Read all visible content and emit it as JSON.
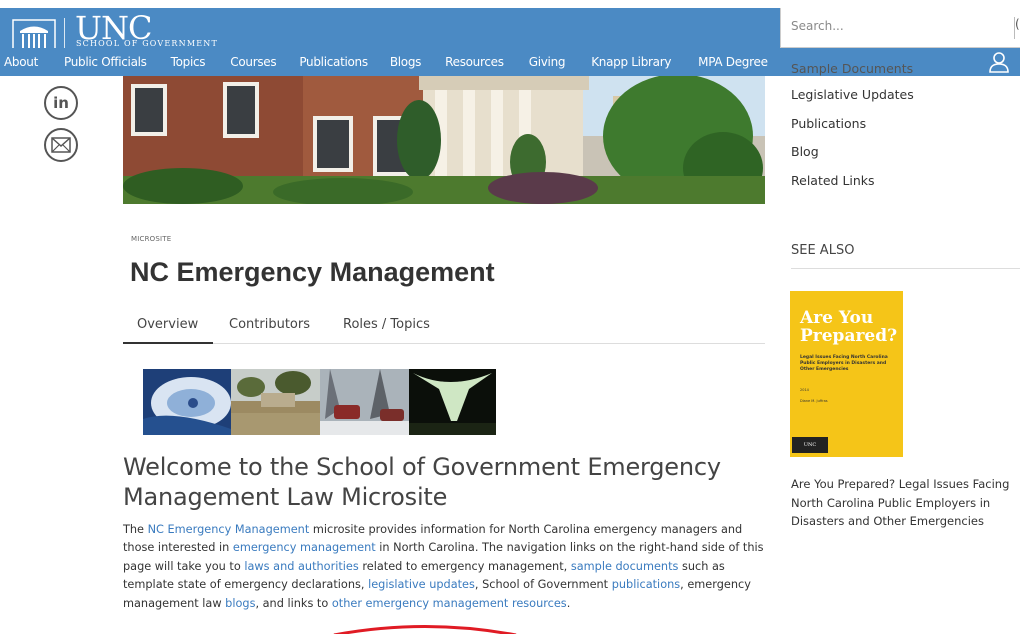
{
  "header": {
    "logo_text": "UNC",
    "logo_subtitle": "SCHOOL OF GOVERNMENT",
    "search_placeholder": "Search...",
    "search_button_partial": "("
  },
  "nav": {
    "items": [
      {
        "label": "About"
      },
      {
        "label": "Public Officials"
      },
      {
        "label": "Topics"
      },
      {
        "label": "Courses"
      },
      {
        "label": "Publications"
      },
      {
        "label": "Blogs"
      },
      {
        "label": "Resources"
      },
      {
        "label": "Giving"
      },
      {
        "label": "Knapp Library"
      },
      {
        "label": "MPA Degree"
      }
    ],
    "user_icon": "user-icon"
  },
  "social": {
    "linkedin_label": "in",
    "icons": [
      "linkedin-icon",
      "email-icon"
    ]
  },
  "page": {
    "eyebrow": "MICROSITE",
    "title": "NC Emergency Management",
    "tabs": [
      {
        "label": "Overview",
        "active": true
      },
      {
        "label": "Contributors",
        "active": false
      },
      {
        "label": "Roles / Topics",
        "active": false
      }
    ]
  },
  "main": {
    "welcome_heading": "Welcome to the School of Government Emergency Management Law Microsite",
    "intro": {
      "t1": "The ",
      "l1": "NC Emergency Management",
      "t2": " microsite provides information for North Carolina emergency managers and those interested in ",
      "l2": "emergency management",
      "t3": " in North Carolina. The navigation links on the right-hand side of this page will take you to ",
      "l3": "laws and authorities",
      "t4": " related to emergency management, ",
      "l4": "sample documents",
      "t5": " such as template state of emergency declarations, ",
      "l5": "legislative updates",
      "t6": ", School of Government ",
      "l6": "publications",
      "t7": ", emergency management law ",
      "l7": "blogs",
      "t8": ", and links to ",
      "l8": "other emergency management resources",
      "t9": "."
    }
  },
  "sidebar": {
    "links": [
      {
        "label": "Sample Documents"
      },
      {
        "label": "Legislative Updates"
      },
      {
        "label": "Publications"
      },
      {
        "label": "Blog"
      },
      {
        "label": "Related Links"
      }
    ],
    "see_also": "SEE ALSO",
    "book": {
      "cover_title": "Are You Prepared?",
      "cover_subtitle": "Legal Issues Facing North Carolina Public Employers in Disasters and Other Emergencies",
      "cover_year": "2014",
      "cover_author": "Diane M. Juffras",
      "cover_badge": "UNC",
      "caption": "Are You Prepared? Legal Issues Facing North Carolina Public Employers in Disasters and Other Emergencies"
    }
  },
  "colors": {
    "brand_blue": "#4b8ac4",
    "link_blue": "#3a7bbf",
    "book_yellow": "#f5c518",
    "annotation_red": "#e01b24"
  }
}
